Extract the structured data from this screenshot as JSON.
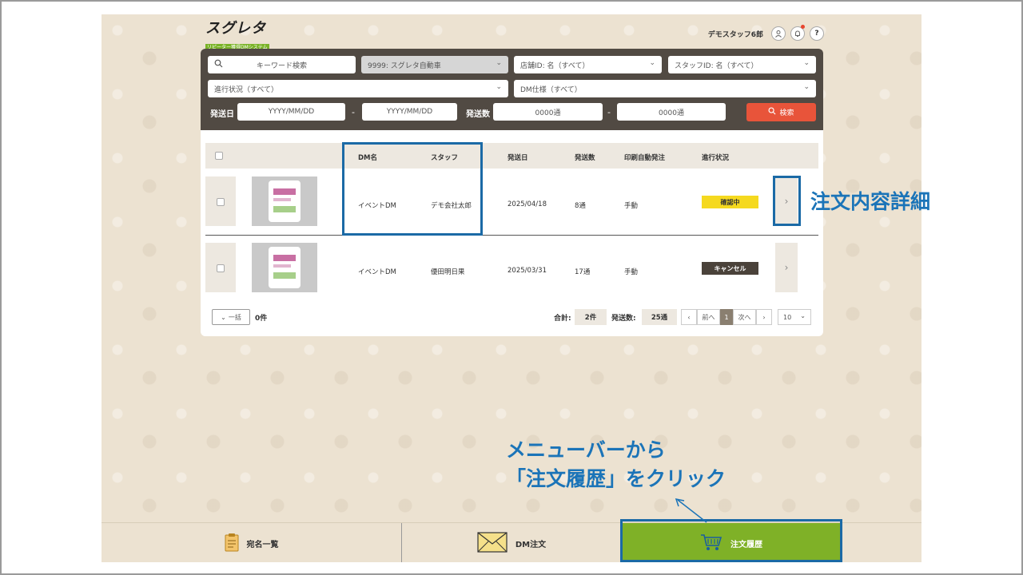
{
  "header": {
    "logo_main": "スグレタ",
    "logo_sub": "リピーター獲得DMシステム",
    "user_name": "デモスタッフ6郎"
  },
  "search": {
    "keyword_placeholder": "キーワード検索",
    "company_select": "9999: スグレタ自動車",
    "store_select": "店舗ID: 名（すべて）",
    "staff_select": "スタッフID: 名（すべて）",
    "progress_select": "進行状況（すべて）",
    "dm_spec_select": "DM仕様（すべて）",
    "send_date_label": "発送日",
    "date_from": "YYYY/MM/DD",
    "date_to": "YYYY/MM/DD",
    "send_count_label": "発送数",
    "count_from": "0000通",
    "count_to": "0000通",
    "dash": "-",
    "search_button": "検索"
  },
  "table": {
    "headers": [
      "DM名",
      "スタッフ",
      "発送日",
      "発送数",
      "印刷自動発注",
      "進行状況"
    ],
    "rows": [
      {
        "dm_name": "イベントDM",
        "staff": "デモ会社太郎",
        "send_date": "2025/04/18",
        "count": "8通",
        "auto_order": "手動",
        "status": "確認中",
        "status_bg": "#f5d91f",
        "status_fg": "#333333"
      },
      {
        "dm_name": "イベントDM",
        "staff": "優田明日果",
        "send_date": "2025/03/31",
        "count": "17通",
        "auto_order": "手動",
        "status": "キャンセル",
        "status_bg": "#4a423a",
        "status_fg": "#ffffff"
      }
    ]
  },
  "footer_bar": {
    "bulk_label": "一括",
    "selected_count": "0件",
    "total_label": "合計:",
    "total_value": "2件",
    "sent_label": "発送数:",
    "sent_value": "25通",
    "prev": "前へ",
    "page": "1",
    "next": "次へ",
    "per_page": "10"
  },
  "nav": {
    "recipients": "宛名一覧",
    "dm_order": "DM注文",
    "order_history": "注文履歴"
  },
  "annotations": {
    "detail": "注文内容詳細",
    "instruction_line1": "メニューバーから",
    "instruction_line2": "「注文履歴」をクリック"
  },
  "colors": {
    "accent_red": "#e8543a",
    "nav_green": "#7fb127",
    "highlight_blue": "#1b6aa6",
    "panel_dark": "#514a43"
  }
}
